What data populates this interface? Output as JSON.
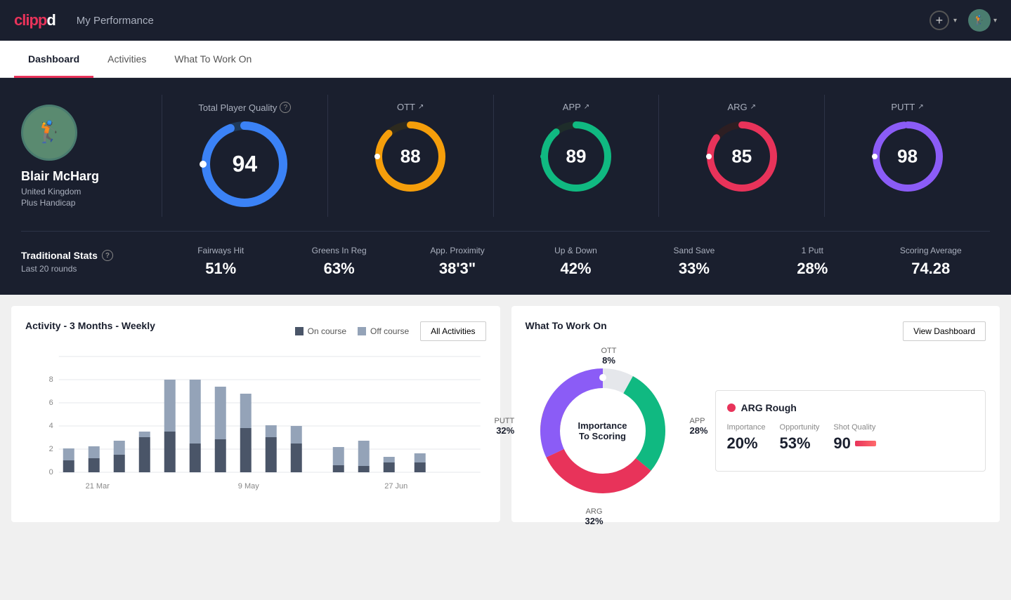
{
  "app": {
    "logo": "clippd",
    "nav_title": "My Performance"
  },
  "tabs": [
    {
      "id": "dashboard",
      "label": "Dashboard",
      "active": true
    },
    {
      "id": "activities",
      "label": "Activities",
      "active": false
    },
    {
      "id": "what-to-work-on",
      "label": "What To Work On",
      "active": false
    }
  ],
  "player": {
    "name": "Blair McHarg",
    "country": "United Kingdom",
    "handicap": "Plus Handicap"
  },
  "scores": {
    "total": {
      "label": "Total Player Quality",
      "value": 94,
      "color": "#3b82f6",
      "bg": "#1e3a5a",
      "pct": 94
    },
    "ott": {
      "label": "OTT",
      "value": 88,
      "color": "#f59e0b",
      "bg": "#2d2a1e",
      "pct": 88
    },
    "app": {
      "label": "APP",
      "value": 89,
      "color": "#10b981",
      "bg": "#1e2d2a",
      "pct": 89
    },
    "arg": {
      "label": "ARG",
      "value": 85,
      "color": "#e8335a",
      "bg": "#2d1e22",
      "pct": 85
    },
    "putt": {
      "label": "PUTT",
      "value": 98,
      "color": "#8b5cf6",
      "bg": "#261e2d",
      "pct": 98
    }
  },
  "trad_stats": {
    "title": "Traditional Stats",
    "subtitle": "Last 20 rounds",
    "items": [
      {
        "label": "Fairways Hit",
        "value": "51%"
      },
      {
        "label": "Greens In Reg",
        "value": "63%"
      },
      {
        "label": "App. Proximity",
        "value": "38'3\""
      },
      {
        "label": "Up & Down",
        "value": "42%"
      },
      {
        "label": "Sand Save",
        "value": "33%"
      },
      {
        "label": "1 Putt",
        "value": "28%"
      },
      {
        "label": "Scoring Average",
        "value": "74.28"
      }
    ]
  },
  "activity_chart": {
    "title": "Activity - 3 Months - Weekly",
    "legend": {
      "on_course": "On course",
      "off_course": "Off course"
    },
    "all_activities_btn": "All Activities",
    "x_labels": [
      "21 Mar",
      "9 May",
      "27 Jun"
    ],
    "bars": [
      {
        "on": 1,
        "off": 1
      },
      {
        "on": 1.2,
        "off": 1.0
      },
      {
        "on": 1.5,
        "off": 1.2
      },
      {
        "on": 3.0,
        "off": 0.5
      },
      {
        "on": 3.5,
        "off": 4.5
      },
      {
        "on": 2.5,
        "off": 5.5
      },
      {
        "on": 2.8,
        "off": 4.5
      },
      {
        "on": 3.8,
        "off": 3.0
      },
      {
        "on": 3.0,
        "off": 1.0
      },
      {
        "on": 2.5,
        "off": 1.5
      },
      {
        "on": 0,
        "off": 0.6
      },
      {
        "on": 0.5,
        "off": 2.2
      },
      {
        "on": 0.8,
        "off": 0.5
      },
      {
        "on": 0.3,
        "off": 0.8
      }
    ],
    "y_labels": [
      "0",
      "2",
      "4",
      "6",
      "8"
    ]
  },
  "what_to_work_on": {
    "title": "What To Work On",
    "view_dashboard_btn": "View Dashboard",
    "donut": {
      "center_text1": "Importance",
      "center_text2": "To Scoring",
      "segments": [
        {
          "label": "OTT",
          "pct": 8,
          "color": "#f59e0b",
          "startAngle": 0
        },
        {
          "label": "APP",
          "pct": 28,
          "color": "#10b981",
          "startAngle": 0
        },
        {
          "label": "ARG",
          "pct": 32,
          "color": "#e8335a",
          "startAngle": 0
        },
        {
          "label": "PUTT",
          "pct": 32,
          "color": "#8b5cf6",
          "startAngle": 0
        }
      ]
    },
    "card": {
      "title": "ARG Rough",
      "color": "#e8335a",
      "importance_label": "Importance",
      "importance_value": "20%",
      "opportunity_label": "Opportunity",
      "opportunity_value": "53%",
      "shot_quality_label": "Shot Quality",
      "shot_quality_value": "90"
    }
  }
}
